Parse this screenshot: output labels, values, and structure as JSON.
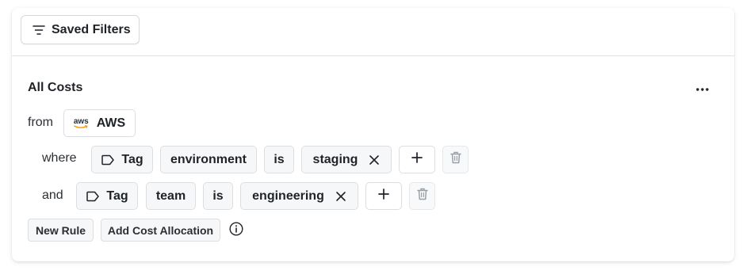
{
  "header": {
    "saved_filters_label": "Saved Filters",
    "saved_filters_icon": "filter-lines-icon"
  },
  "section": {
    "title": "All Costs",
    "menu_icon": "more-horizontal-icon"
  },
  "source": {
    "from_label": "from",
    "provider_logo_text": "aws",
    "provider_label": "AWS"
  },
  "rules": [
    {
      "connector": "where",
      "type_label": "Tag",
      "type_icon": "tag-icon",
      "key": "environment",
      "operator": "is",
      "value": "staging"
    },
    {
      "connector": "and",
      "type_label": "Tag",
      "type_icon": "tag-icon",
      "key": "team",
      "operator": "is",
      "value": "engineering"
    }
  ],
  "footer": {
    "new_rule_label": "New Rule",
    "add_allocation_label": "Add Cost Allocation",
    "info_icon": "info-icon"
  },
  "colors": {
    "border": "#dcdee1",
    "chip_bg": "#f6f7f8",
    "text": "#1f2328",
    "aws_orange": "#f79400"
  }
}
